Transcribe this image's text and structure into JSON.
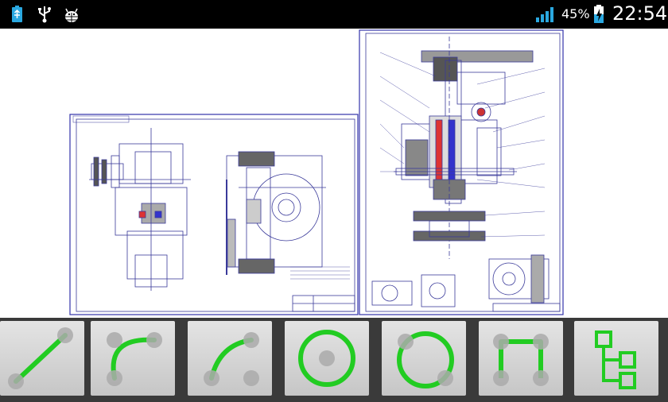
{
  "status_bar": {
    "battery_percent": "45%",
    "time": "22:54",
    "signal_bars_filled": 4,
    "left_icons": [
      "usb-battery-icon",
      "usb-icon",
      "android-debug-icon"
    ],
    "right_icons": [
      "signal-icon",
      "battery-charging-icon"
    ]
  },
  "toolbar": {
    "tools": [
      {
        "id": "line",
        "icon": "line-tool-icon"
      },
      {
        "id": "arc-three-point",
        "icon": "arc-three-point-icon"
      },
      {
        "id": "arc",
        "icon": "arc-tool-icon"
      },
      {
        "id": "circle",
        "icon": "circle-tool-icon"
      },
      {
        "id": "circle-two-point",
        "icon": "circle-two-point-icon"
      },
      {
        "id": "polyline",
        "icon": "polyline-tool-icon"
      },
      {
        "id": "layers",
        "icon": "layers-tree-icon"
      }
    ],
    "accent_color": "#22cc22"
  },
  "colors": {
    "status_bar_bg": "#000000",
    "drawing_border": "#3333aa",
    "toolbar_bg": "#3a3a3a",
    "signal_color": "#2aa8e0",
    "charging_color": "#2aa8e0"
  }
}
